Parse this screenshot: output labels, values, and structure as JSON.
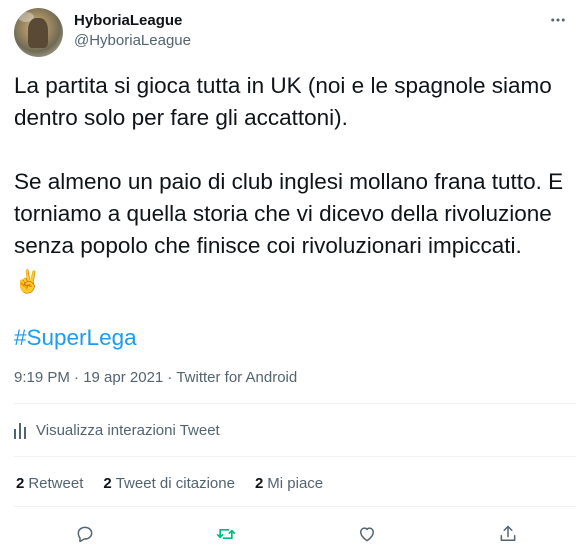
{
  "author": {
    "display_name": "HyboriaLeague",
    "handle": "@HyboriaLeague"
  },
  "tweet": {
    "paragraph_1": "La partita si gioca tutta in UK (noi e le spagnole siamo dentro solo per fare gli accattoni).",
    "paragraph_2": "Se almeno un paio di club inglesi mollano frana tutto. E torniamo a quella storia che vi dicevo della rivoluzione senza popolo che finisce coi rivoluzionari impiccati.",
    "emoji": "✌️",
    "hashtag": "#SuperLega"
  },
  "meta": {
    "line": "9:19 PM · 19 apr 2021 · Twitter for Android"
  },
  "analytics": {
    "label": "Visualizza interazioni Tweet"
  },
  "stats": {
    "retweets_count": "2",
    "retweets_label": "Retweet",
    "quotes_count": "2",
    "quotes_label": "Tweet di citazione",
    "likes_count": "2",
    "likes_label": "Mi piace"
  },
  "icons": {
    "more": "more-icon",
    "analytics": "analytics-icon",
    "reply": "reply-icon",
    "retweet": "retweet-icon",
    "like": "like-icon",
    "share": "share-icon"
  },
  "colors": {
    "text": "#0f1419",
    "secondary": "#536471",
    "link": "#1d9bf0",
    "retweet_active": "#00ba7c",
    "divider": "#eff3f4"
  }
}
